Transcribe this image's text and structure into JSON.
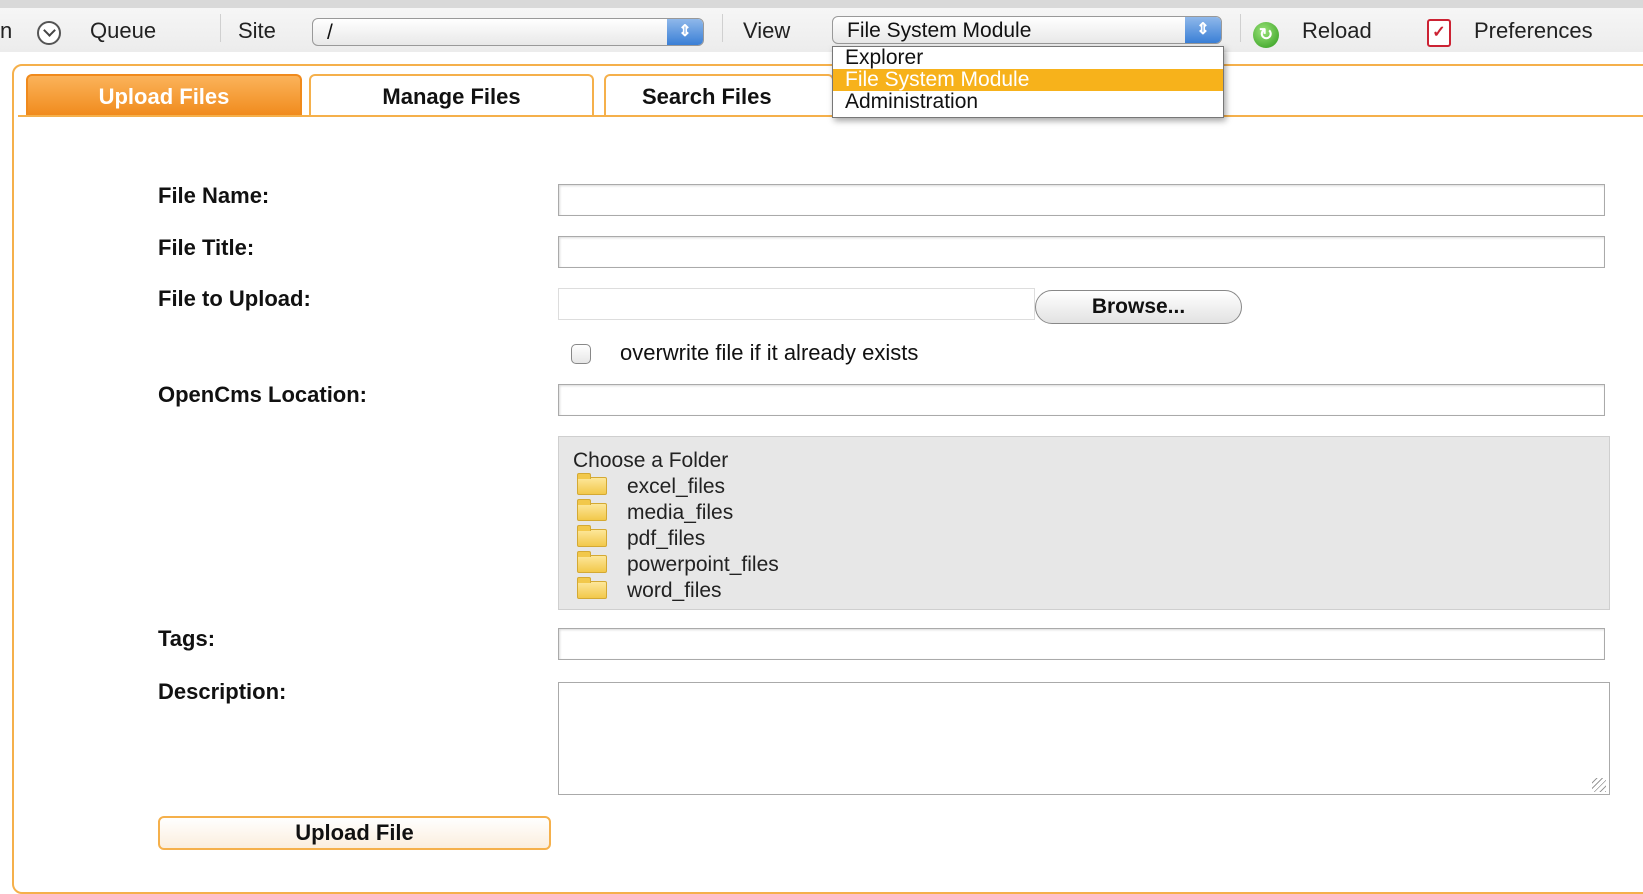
{
  "toolbar": {
    "truncated_left": "n",
    "queue_label": "Queue",
    "site_label": "Site",
    "site_value": "/",
    "view_label": "View",
    "view_value": "File System Module",
    "reload_label": "Reload",
    "preferences_label": "Preferences"
  },
  "view_dropdown": {
    "options": [
      "Explorer",
      "File System Module",
      "Administration"
    ],
    "selected": "File System Module"
  },
  "tabs": [
    {
      "label": "Upload Files",
      "active": true
    },
    {
      "label": "Manage Files",
      "active": false
    },
    {
      "label": "Search Files",
      "active": false
    }
  ],
  "form": {
    "file_name_label": "File Name:",
    "file_name_value": "",
    "file_title_label": "File Title:",
    "file_title_value": "",
    "file_to_upload_label": "File to Upload:",
    "browse_label": "Browse...",
    "overwrite_label": "overwrite file if it already exists",
    "overwrite_checked": false,
    "location_label": "OpenCms Location:",
    "location_value": "",
    "folder_chooser": {
      "title": "Choose a Folder",
      "folders": [
        "excel_files",
        "media_files",
        "pdf_files",
        "powerpoint_files",
        "word_files"
      ]
    },
    "tags_label": "Tags:",
    "tags_value": "",
    "description_label": "Description:",
    "description_value": "",
    "submit_label": "Upload File"
  },
  "colors": {
    "accent": "#f5b04b",
    "active_tab": "#f08a1c",
    "dropdown_highlight": "#f7b21b",
    "folder_panel": "#e7e7e7"
  }
}
